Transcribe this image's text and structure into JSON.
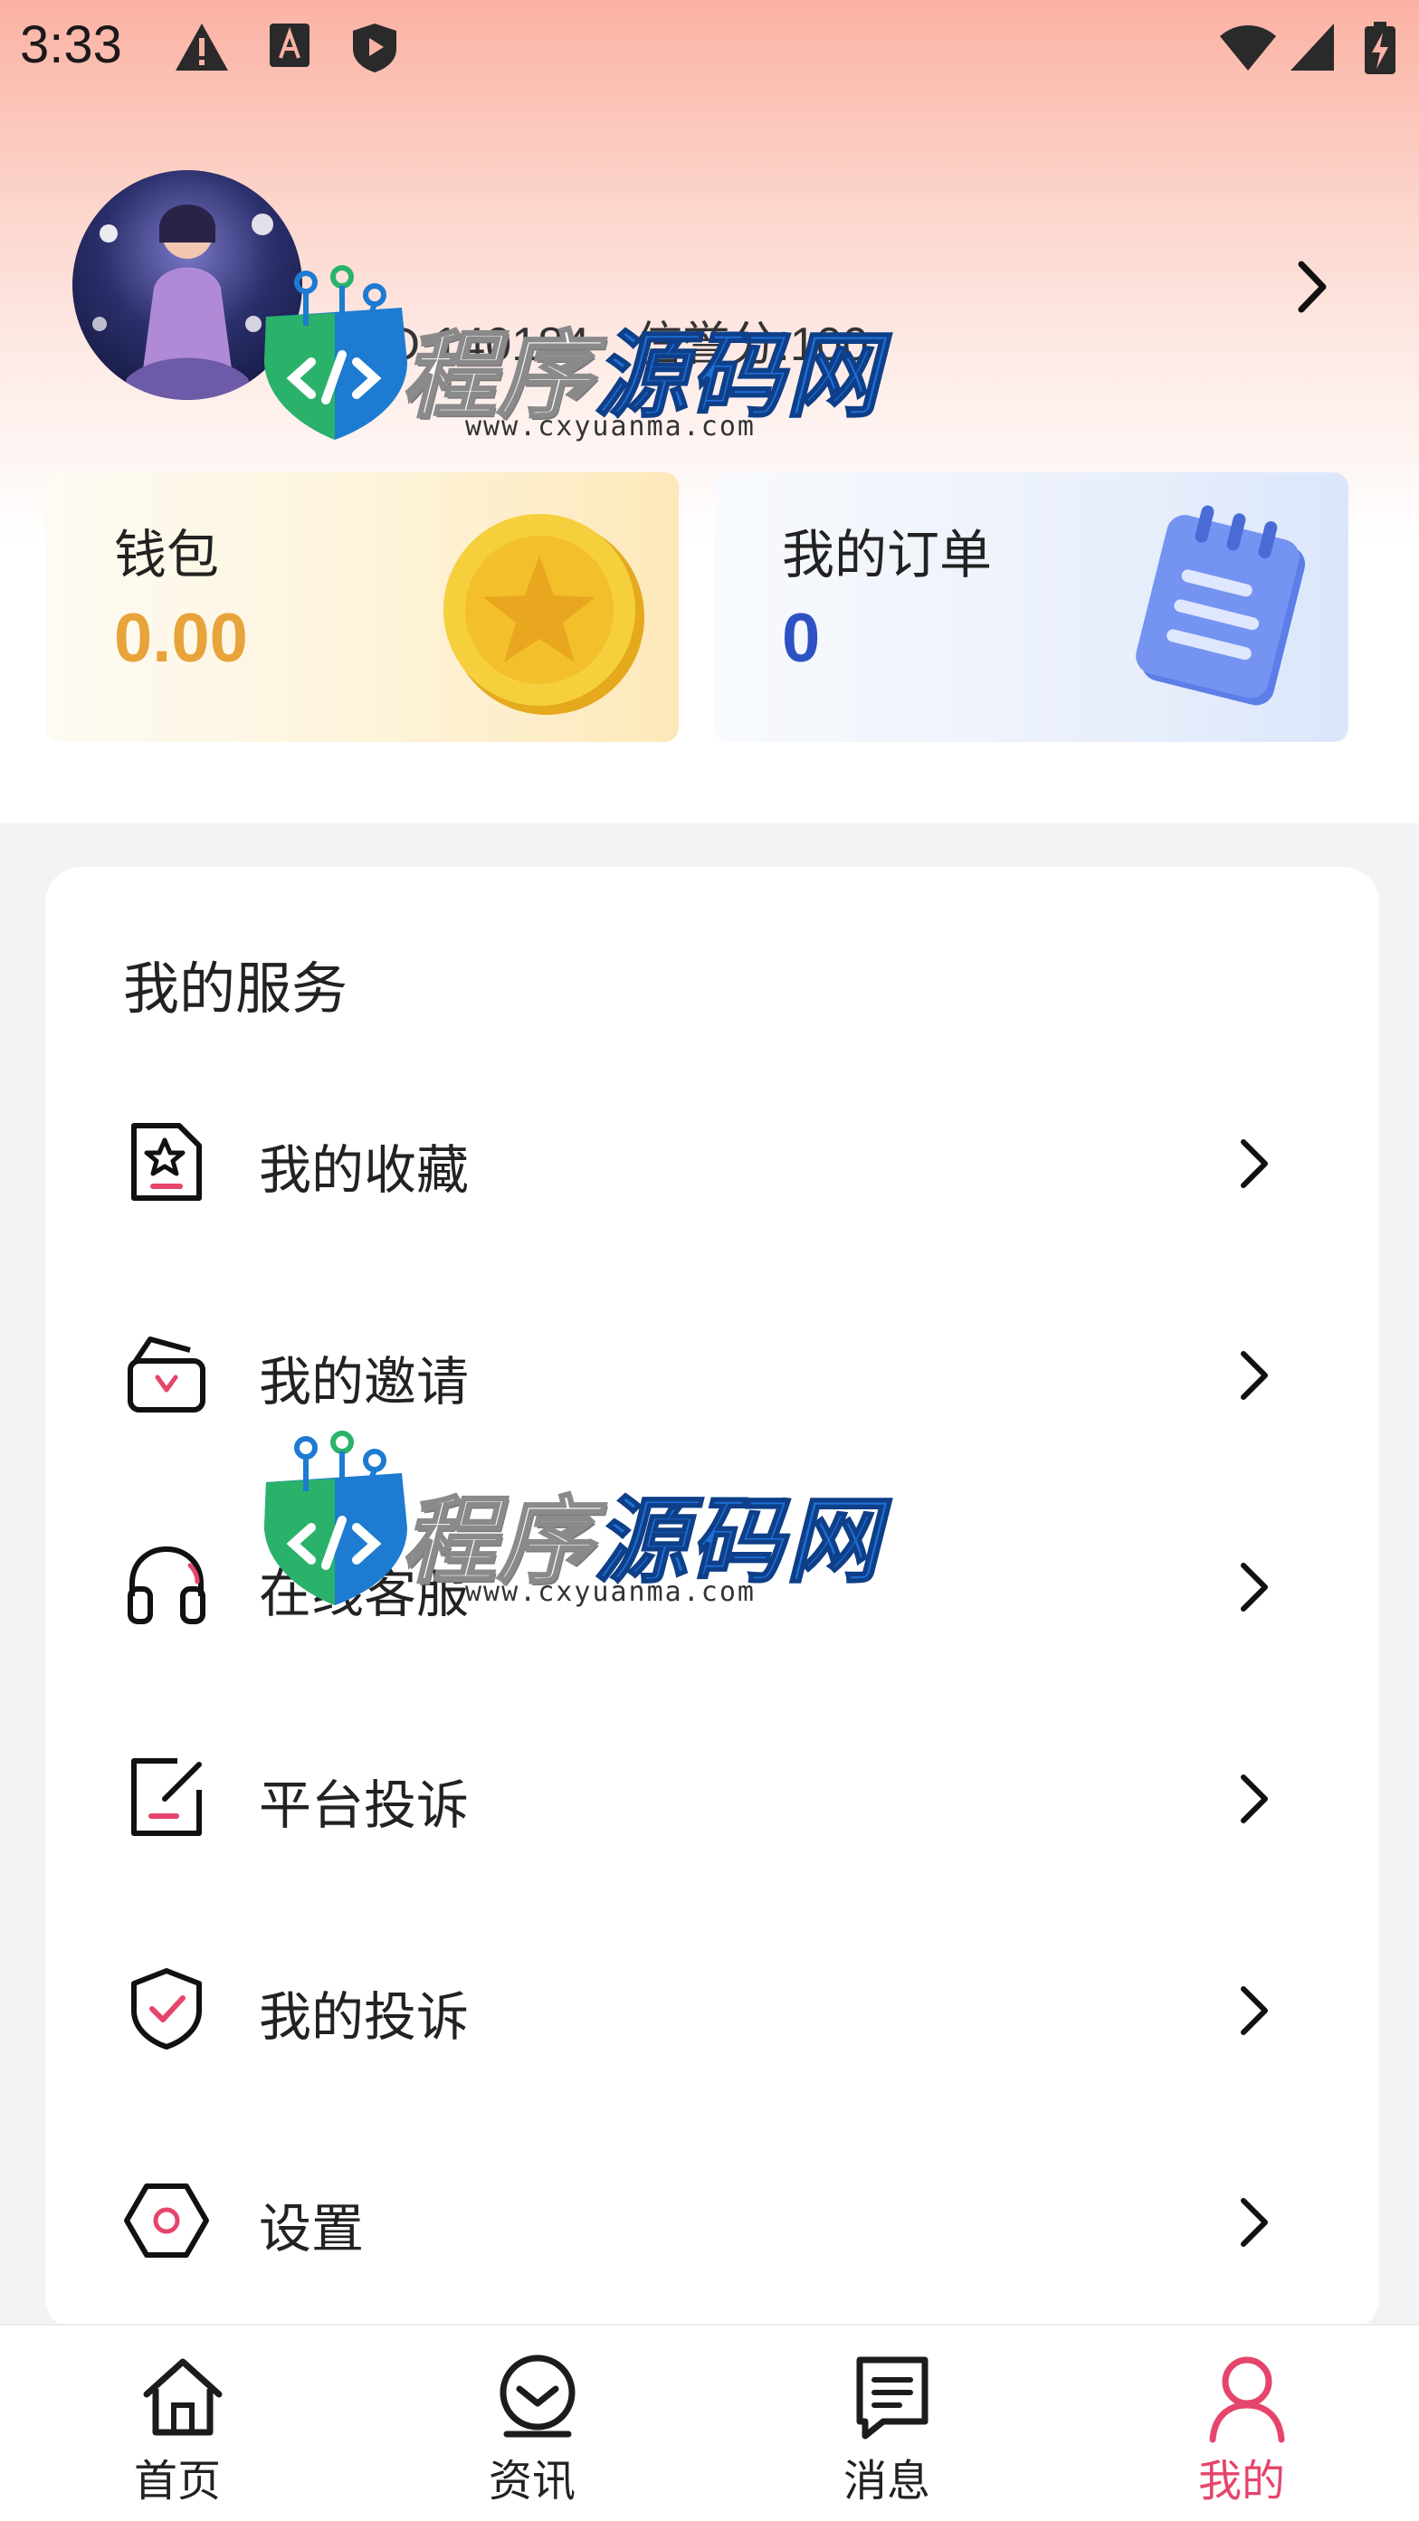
{
  "status_bar": {
    "time": "3:33",
    "left_icons": [
      "warning-icon",
      "font-icon",
      "shield-play-icon"
    ],
    "right_icons": [
      "wifi-icon",
      "signal-icon",
      "battery-charging-icon"
    ]
  },
  "profile": {
    "user_id_label": "户ID:140184",
    "credit_label": "信誉分:100"
  },
  "cards": {
    "wallet": {
      "label": "钱包",
      "value": "0.00"
    },
    "orders": {
      "label": "我的订单",
      "value": "0"
    }
  },
  "services": {
    "title": "我的服务",
    "items": [
      {
        "label": "我的收藏",
        "icon": "favorites-doc-icon"
      },
      {
        "label": "我的邀请",
        "icon": "invite-bag-icon"
      },
      {
        "label": "在线客服",
        "icon": "headset-icon"
      },
      {
        "label": "平台投诉",
        "icon": "edit-note-icon"
      },
      {
        "label": "我的投诉",
        "icon": "shield-check-icon"
      },
      {
        "label": "设置",
        "icon": "settings-hexagon-icon"
      }
    ]
  },
  "tabbar": {
    "items": [
      {
        "label": "首页",
        "icon": "home-icon"
      },
      {
        "label": "资讯",
        "icon": "news-icon"
      },
      {
        "label": "消息",
        "icon": "message-icon"
      },
      {
        "label": "我的",
        "icon": "user-icon",
        "active": true
      }
    ]
  },
  "watermark": {
    "text_a": "程序",
    "text_b": "源码网",
    "url": "www.cxyuanma.com"
  },
  "colors": {
    "accent": "#e6456b",
    "wallet_value": "#e8a33a",
    "orders_value": "#2e52c4",
    "header_gradient_top": "#fbb2a4"
  }
}
